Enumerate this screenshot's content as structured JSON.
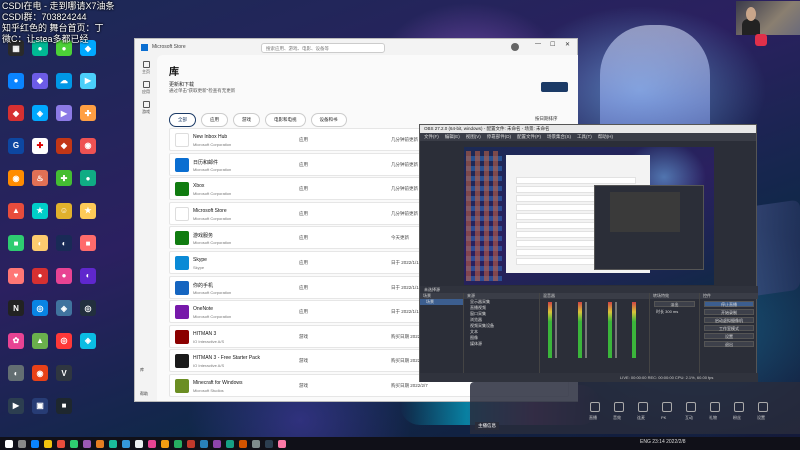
{
  "overlay": {
    "lines": [
      "CSDI在电 - 走到哪请X7油条",
      "CSDI群：703824244",
      "知乎红色的 舞台首页：丁",
      "微C：让stea多都已经"
    ]
  },
  "desktop_icons": {
    "col1": [
      {
        "label": "",
        "color": "#2a2a2a",
        "glyph": "▦"
      },
      {
        "label": "",
        "color": "#0a84ff",
        "glyph": "●"
      },
      {
        "label": "",
        "color": "#d63031",
        "glyph": "◆"
      },
      {
        "label": "",
        "color": "#0d47a1",
        "glyph": "G"
      },
      {
        "label": "",
        "color": "#ff8c00",
        "glyph": "◉"
      },
      {
        "label": "",
        "color": "#e74c3c",
        "glyph": "▲"
      },
      {
        "label": "",
        "color": "#2ecc71",
        "glyph": "■"
      },
      {
        "label": "",
        "color": "#ff7675",
        "glyph": "♥"
      },
      {
        "label": "",
        "color": "#222",
        "glyph": "N"
      },
      {
        "label": "",
        "color": "#e84393",
        "glyph": "✿"
      },
      {
        "label": "",
        "color": "#636e72",
        "glyph": "◐"
      },
      {
        "label": "",
        "color": "#2c3e50",
        "glyph": "▶"
      }
    ],
    "col2": [
      {
        "label": "",
        "color": "#00b894",
        "glyph": "●"
      },
      {
        "label": "",
        "color": "#6c5ce7",
        "glyph": "◆"
      },
      {
        "label": "",
        "color": "#00a8ff",
        "glyph": "◈"
      },
      {
        "label": "",
        "color": "#ffffff",
        "glyph": "✚"
      },
      {
        "label": "",
        "color": "#e17055",
        "glyph": "♨"
      },
      {
        "label": "",
        "color": "#00cec9",
        "glyph": "★"
      },
      {
        "label": "",
        "color": "#fdcb6e",
        "glyph": "◐"
      },
      {
        "label": "",
        "color": "#d63031",
        "glyph": "●"
      },
      {
        "label": "",
        "color": "#0984e3",
        "glyph": "◎"
      },
      {
        "label": "",
        "color": "#6ab04c",
        "glyph": "▲"
      },
      {
        "label": "",
        "color": "#e84118",
        "glyph": "◉"
      },
      {
        "label": "",
        "color": "#273c75",
        "glyph": "▣"
      }
    ],
    "col3": [
      {
        "label": "",
        "color": "#4cd137",
        "glyph": "●"
      },
      {
        "label": "",
        "color": "#0097e6",
        "glyph": "☁"
      },
      {
        "label": "",
        "color": "#8c7ae6",
        "glyph": "▶"
      },
      {
        "label": "",
        "color": "#c23616",
        "glyph": "◆"
      },
      {
        "label": "",
        "color": "#44bd32",
        "glyph": "✚"
      },
      {
        "label": "",
        "color": "#e1b12c",
        "glyph": "☺"
      },
      {
        "label": "",
        "color": "#192a56",
        "glyph": "◐"
      },
      {
        "label": "",
        "color": "#e84393",
        "glyph": "●"
      },
      {
        "label": "",
        "color": "#40739e",
        "glyph": "◈"
      },
      {
        "label": "",
        "color": "#ff3838",
        "glyph": "◎"
      },
      {
        "label": "",
        "color": "#2f3640",
        "glyph": "V"
      },
      {
        "label": "",
        "color": "#1e272e",
        "glyph": "■"
      }
    ],
    "col4": [
      {
        "label": "",
        "color": "#00a8ff",
        "glyph": "◆"
      },
      {
        "label": "",
        "color": "#4bcffa",
        "glyph": "▶"
      },
      {
        "label": "",
        "color": "#ff9f43",
        "glyph": "✚"
      },
      {
        "label": "",
        "color": "#ee5253",
        "glyph": "◉"
      },
      {
        "label": "",
        "color": "#10ac84",
        "glyph": "●"
      },
      {
        "label": "",
        "color": "#feca57",
        "glyph": "★"
      },
      {
        "label": "",
        "color": "#ff6b6b",
        "glyph": "■"
      },
      {
        "label": "",
        "color": "#5f27cd",
        "glyph": "◐"
      },
      {
        "label": "",
        "color": "#222f3e",
        "glyph": "◎"
      },
      {
        "label": "",
        "color": "#0abde3",
        "glyph": "◈"
      }
    ]
  },
  "store": {
    "app_title": "Microsoft Store",
    "search_placeholder": "搜索应用、游戏、电影、设备等",
    "nav": [
      {
        "label": "主页"
      },
      {
        "label": "应用"
      },
      {
        "label": "游戏"
      }
    ],
    "library_title": "库",
    "updates_title": "更新和下载",
    "updates_sub": "通过单击\"获取更新\"检查有无更新",
    "get_updates_label": "",
    "tabs": [
      "全部",
      "应用",
      "游戏",
      "电影和电视",
      "设备和书"
    ],
    "sort_label": "按日期排序",
    "rows": [
      {
        "name": "New Inbox Hub",
        "publisher": "Microsoft Corporation",
        "type": "应用",
        "date": "几分钟前更新",
        "icon_color": "#ffffff"
      },
      {
        "name": "日历和邮件",
        "publisher": "Microsoft Corporation",
        "type": "应用",
        "date": "几分钟前更新",
        "icon_color": "#0a6ed1"
      },
      {
        "name": "Xbox",
        "publisher": "Microsoft Corporation",
        "type": "应用",
        "date": "几分钟前更新",
        "icon_color": "#107c10"
      },
      {
        "name": "Microsoft Store",
        "publisher": "Microsoft Corporation",
        "type": "应用",
        "date": "几分钟前更新",
        "icon_color": "#ffffff"
      },
      {
        "name": "游戏服务",
        "publisher": "Microsoft Corporation",
        "type": "应用",
        "date": "今天更新",
        "icon_color": "#107c10"
      },
      {
        "name": "Skype",
        "publisher": "Skype",
        "type": "应用",
        "date": "日于 2022/1/18 更新",
        "icon_color": "#0a8ad6"
      },
      {
        "name": "你的手机",
        "publisher": "Microsoft Corporation",
        "type": "应用",
        "date": "日于 2022/1/18 更新",
        "icon_color": "#1565c0"
      },
      {
        "name": "OneNote",
        "publisher": "Microsoft Corporation",
        "type": "应用",
        "date": "日于 2022/1/18 更新",
        "icon_color": "#7719aa"
      },
      {
        "name": "HITMAN 3",
        "publisher": "IO Interactive A/S",
        "type": "游戏",
        "date": "购买日期 2022/2/7",
        "icon_color": "#8b0000"
      },
      {
        "name": "HITMAN 3 - Free Starter Pack",
        "publisher": "IO Interactive A/S",
        "type": "游戏",
        "date": "购买日期 2022/2/7",
        "icon_color": "#1a1a1a"
      },
      {
        "name": "Minecraft for Windows",
        "publisher": "Microsoft Studios",
        "type": "游戏",
        "date": "购买日期 2022/2/7",
        "icon_color": "#6b8e23"
      }
    ],
    "bottom_nav": [
      {
        "label": "库"
      },
      {
        "label": "帮助"
      }
    ]
  },
  "obs": {
    "title": "OBS 27.2.0 (64-bit, windows) - 配置文件: 未命名 - 场景: 未命名",
    "menu": [
      "文件(F)",
      "编辑(E)",
      "视图(V)",
      "停靠部件(D)",
      "配置文件(P)",
      "场景集合(S)",
      "工具(T)",
      "帮助(H)"
    ],
    "control_bar": "未选择源",
    "scenes_header": "场景",
    "scenes": [
      "场景"
    ],
    "sources_header": "来源",
    "sources": [
      "显示器采集",
      "直播视频",
      "窗口采集",
      "浏览器",
      "视频采集设备",
      "文本",
      "图像",
      "媒体源"
    ],
    "mixer_header": "混音器",
    "transitions_header": "转场特效",
    "transition_value": "淡出",
    "duration_label": "时长",
    "duration_value": "300 ms",
    "controls_header": "控件",
    "controls": [
      "停止直播",
      "开始录制",
      "启动虚拟摄像机",
      "工作室模式",
      "设置",
      "退出"
    ],
    "status": "LIVE: 00:00:00   REC: 00:00:00   CPU: 2.1%, 60.00 fps"
  },
  "floatbar": {
    "labels": [
      "直播",
      "音效",
      "连麦",
      "PK",
      "互动",
      "礼物",
      "粉丝",
      "设置"
    ],
    "live_label": "主播信息"
  },
  "taskbar": {
    "icon_colors": [
      "#ffffff",
      "#888888",
      "#0a84ff",
      "#f1c40f",
      "#e74c3c",
      "#2ecc71",
      "#9b59b6",
      "#e67e22",
      "#1abc9c",
      "#3498db",
      "#ecf0f1",
      "#e84393",
      "#f39c12",
      "#27ae60",
      "#c0392b",
      "#2980b9",
      "#8e44ad",
      "#16a085",
      "#d35400",
      "#7f8c8d",
      "#2c3e50",
      "#fd79a8"
    ],
    "tray_text": "ENG  23:14  2022/2/8"
  }
}
